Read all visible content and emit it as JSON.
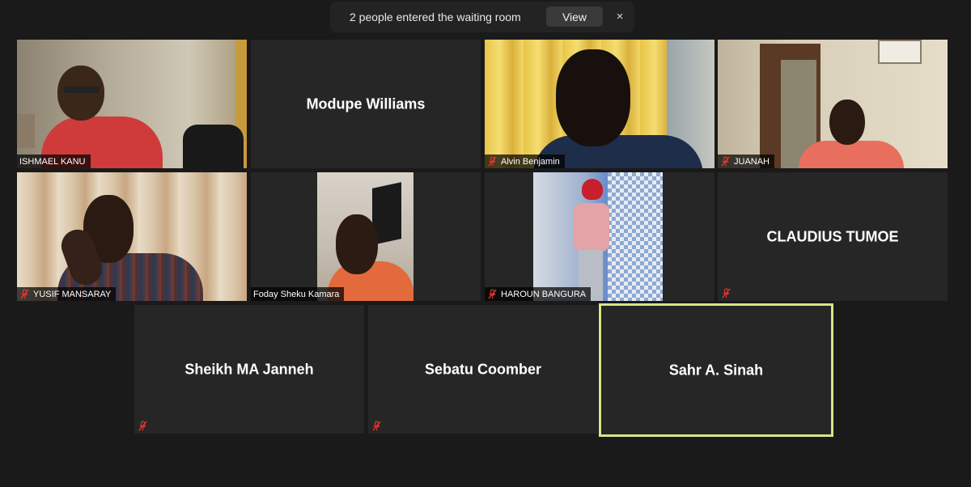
{
  "notification": {
    "text": "2 people entered the waiting room",
    "view_label": "View",
    "close_label": "×"
  },
  "participants": [
    {
      "name": "ISHMAEL KANU",
      "muted": false,
      "video": true
    },
    {
      "name": "Modupe Williams",
      "muted": false,
      "video": false
    },
    {
      "name": "Alvin Benjamin",
      "muted": true,
      "video": true
    },
    {
      "name": "JUANAH",
      "muted": true,
      "video": true
    },
    {
      "name": "YUSIF MANSARAY",
      "muted": true,
      "video": true
    },
    {
      "name": "Foday Sheku Kamara",
      "muted": false,
      "video": true
    },
    {
      "name": "HAROUN BANGURA",
      "muted": true,
      "video": true
    },
    {
      "name": "CLAUDIUS TUMOE",
      "muted": true,
      "video": false
    },
    {
      "name": "Sheikh MA Janneh",
      "muted": true,
      "video": false
    },
    {
      "name": "Sebatu Coomber",
      "muted": true,
      "video": false
    },
    {
      "name": "Sahr A. Sinah",
      "muted": false,
      "video": false,
      "active_speaker": true
    }
  ],
  "colors": {
    "background": "#1a1a1a",
    "tile": "#262626",
    "active_speaker_border": "#d9e38a",
    "mute_icon": "#e0362f"
  }
}
